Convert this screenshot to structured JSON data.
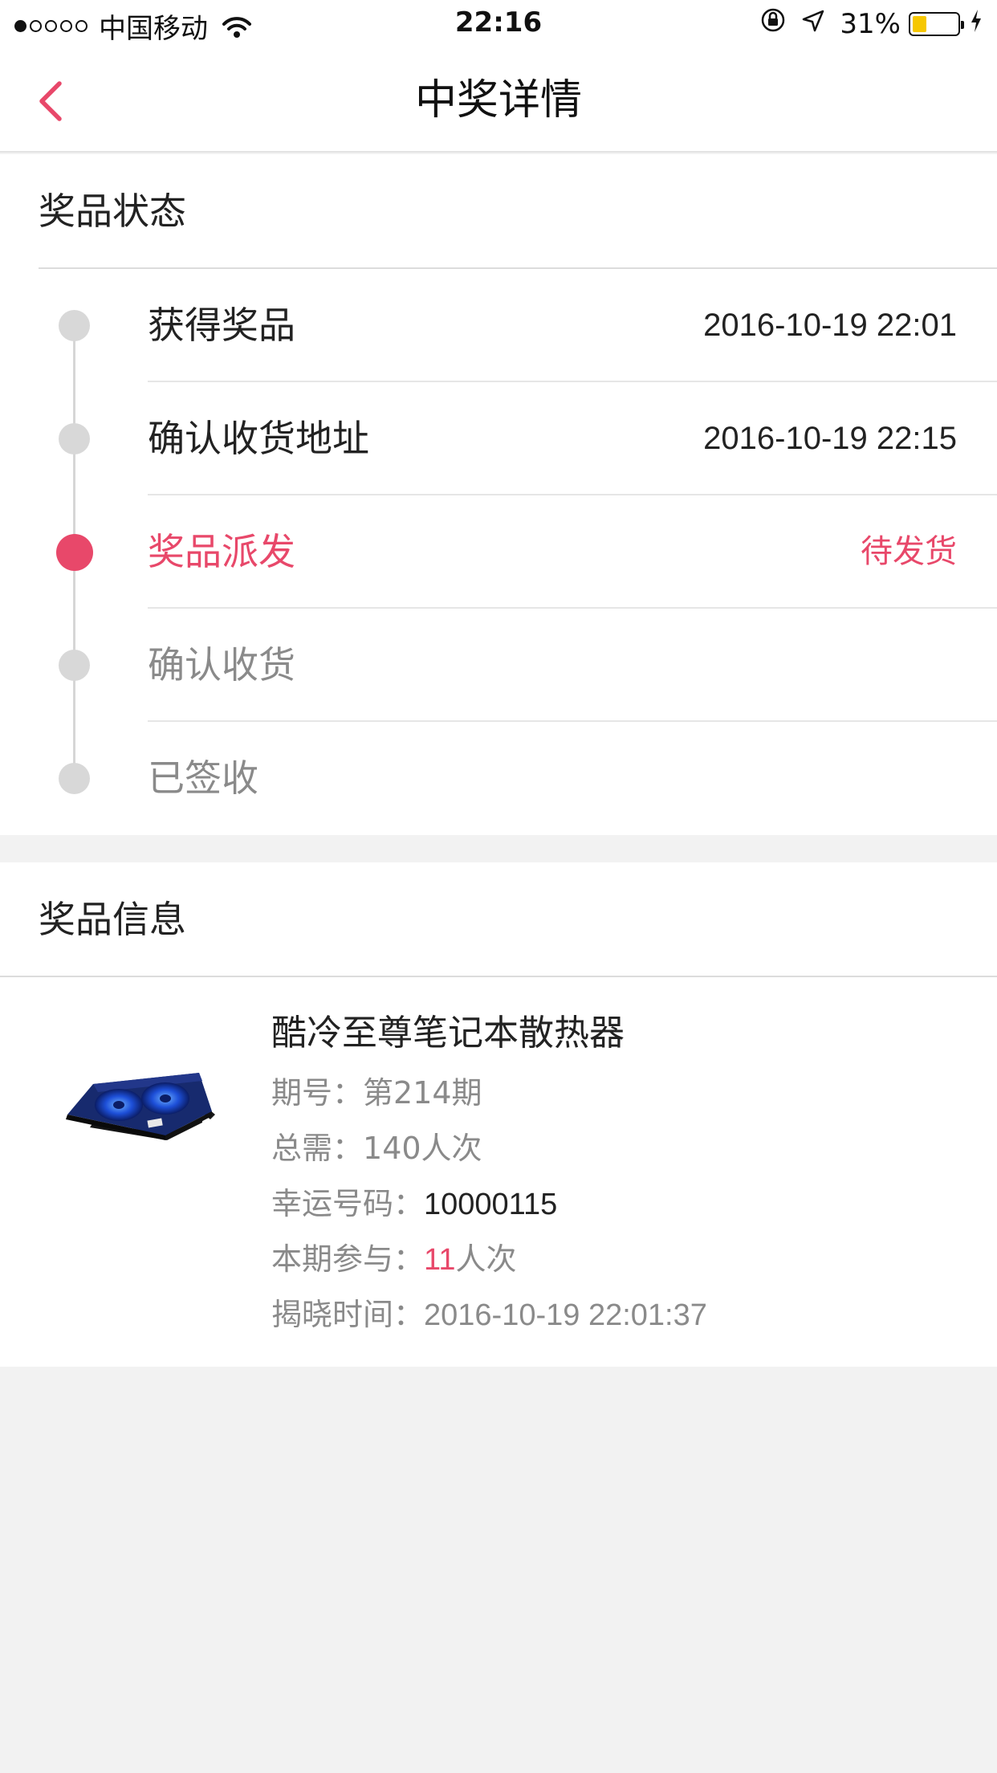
{
  "status_bar": {
    "signal_dots": [
      true,
      false,
      false,
      false,
      false
    ],
    "carrier": "中国移动",
    "time": "22:16",
    "battery_percent": "31%",
    "battery_level": 0.31,
    "icons": [
      "wifi-icon",
      "orientation-lock-icon",
      "location-arrow-icon",
      "battery-icon",
      "charging-bolt-icon"
    ]
  },
  "nav": {
    "title": "中奖详情",
    "back_icon": "chevron-left-icon",
    "accent_color": "#e8486a"
  },
  "prize_status": {
    "header": "奖品状态",
    "steps": [
      {
        "label": "获得奖品",
        "time": "2016-10-19 22:01",
        "state": "done"
      },
      {
        "label": "确认收货地址",
        "time": "2016-10-19 22:15",
        "state": "done"
      },
      {
        "label": "奖品派发",
        "time": "待发货",
        "state": "active"
      },
      {
        "label": "确认收货",
        "time": "",
        "state": "pending"
      },
      {
        "label": "已签收",
        "time": "",
        "state": "pending"
      }
    ]
  },
  "prize_info": {
    "header": "奖品信息",
    "product_name": "酷冷至尊笔记本散热器",
    "issue_label": "期号：",
    "issue_value": "第214期",
    "total_label": "总需：",
    "total_value": "140人次",
    "lucky_label": "幸运号码：",
    "lucky_value": "10000115",
    "participate_label": "本期参与：",
    "participate_count": "11",
    "participate_unit": "人次",
    "reveal_label": "揭晓时间：",
    "reveal_value": "2016-10-19 22:01:37"
  }
}
